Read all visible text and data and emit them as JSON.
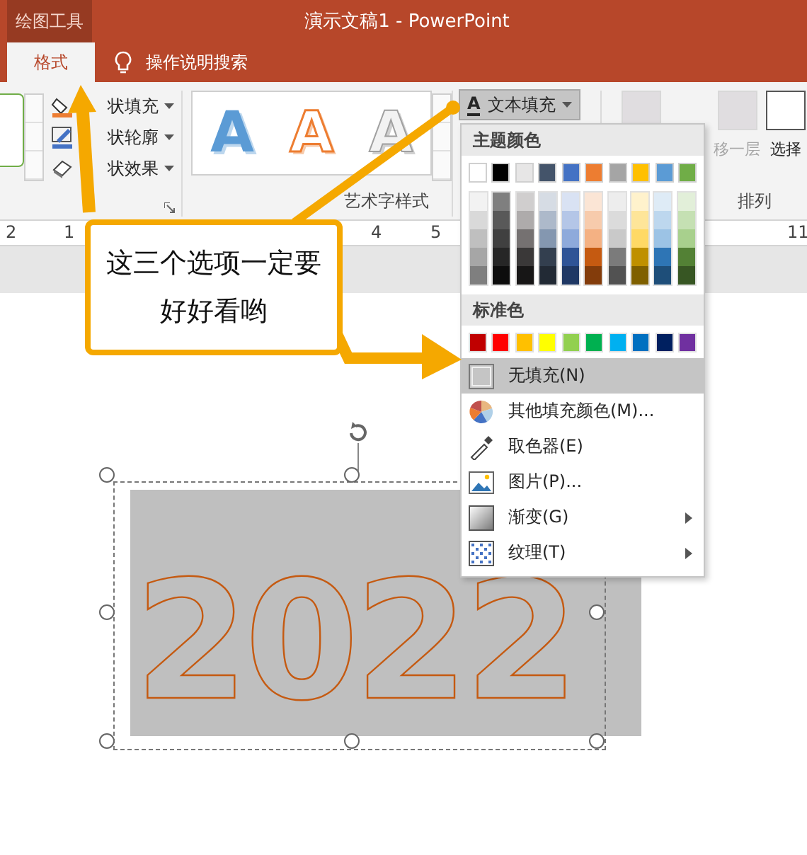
{
  "title_bar": {
    "context_tab": "绘图工具",
    "title": "演示文稿1  -  PowerPoint"
  },
  "tabs": [
    {
      "label": "格式",
      "selected": true
    }
  ],
  "tell_me": "操作说明搜索",
  "ribbon": {
    "shape_commands": [
      {
        "label": "状填充",
        "kind": "fill"
      },
      {
        "label": "状轮廓",
        "kind": "outline"
      },
      {
        "label": "状效果",
        "kind": "effect"
      }
    ],
    "wordart_styles": [
      {
        "sample": "A",
        "kind": "blue"
      },
      {
        "sample": "A",
        "kind": "orange"
      },
      {
        "sample": "A",
        "kind": "gray"
      }
    ],
    "wordart_group": "艺术字样式",
    "text_fill_button": {
      "icon": "A",
      "label": "文本填充",
      "expanded": true
    },
    "arrange": {
      "items": [
        {
          "label": "移一层",
          "disabled": true
        },
        {
          "label": "选择",
          "disabled": false
        }
      ],
      "label": "排列"
    }
  },
  "ruler": [
    "2",
    "1",
    "4",
    "5",
    "11"
  ],
  "menu": {
    "theme_heading": "主题颜色",
    "theme_colors": [
      {
        "color": "#ffffff",
        "shades": [
          {
            "color": "#f2f2f2"
          },
          {
            "color": "#d9d9d9"
          },
          {
            "color": "#bfbfbf"
          },
          {
            "color": "#a6a6a6"
          },
          {
            "color": "#7f7f7f"
          }
        ]
      },
      {
        "color": "#000000",
        "shades": [
          {
            "color": "#7f7f7f"
          },
          {
            "color": "#595959"
          },
          {
            "color": "#404040"
          },
          {
            "color": "#262626"
          },
          {
            "color": "#0d0d0d"
          }
        ]
      },
      {
        "color": "#e7e6e6",
        "shades": [
          {
            "color": "#d0cece"
          },
          {
            "color": "#aeabab"
          },
          {
            "color": "#757171"
          },
          {
            "color": "#3a3838"
          },
          {
            "color": "#171616"
          }
        ]
      },
      {
        "color": "#44546a",
        "shades": [
          {
            "color": "#d6dce4"
          },
          {
            "color": "#adb9ca"
          },
          {
            "color": "#8497b0"
          },
          {
            "color": "#333f4f"
          },
          {
            "color": "#222a35"
          }
        ]
      },
      {
        "color": "#4472c4",
        "shades": [
          {
            "color": "#d9e2f3"
          },
          {
            "color": "#b4c6e7"
          },
          {
            "color": "#8eaadb"
          },
          {
            "color": "#2f5496"
          },
          {
            "color": "#1f3864"
          }
        ]
      },
      {
        "color": "#ed7d31",
        "shades": [
          {
            "color": "#fbe5d5"
          },
          {
            "color": "#f7cbac"
          },
          {
            "color": "#f4b183"
          },
          {
            "color": "#c55a11"
          },
          {
            "color": "#833c0b"
          }
        ]
      },
      {
        "color": "#a5a5a5",
        "shades": [
          {
            "color": "#ededed"
          },
          {
            "color": "#dbdbdb"
          },
          {
            "color": "#c9c9c9"
          },
          {
            "color": "#7b7b7b"
          },
          {
            "color": "#525252"
          }
        ]
      },
      {
        "color": "#ffc000",
        "shades": [
          {
            "color": "#fff2cc"
          },
          {
            "color": "#fee599"
          },
          {
            "color": "#ffd965"
          },
          {
            "color": "#bf9000"
          },
          {
            "color": "#7f6000"
          }
        ]
      },
      {
        "color": "#5b9bd5",
        "shades": [
          {
            "color": "#deebf6"
          },
          {
            "color": "#bdd7ee"
          },
          {
            "color": "#9cc3e5"
          },
          {
            "color": "#2e75b5"
          },
          {
            "color": "#1e4e79"
          }
        ]
      },
      {
        "color": "#70ad47",
        "shades": [
          {
            "color": "#e2efd9"
          },
          {
            "color": "#c5e0b3"
          },
          {
            "color": "#a8d08d"
          },
          {
            "color": "#538135"
          },
          {
            "color": "#375623"
          }
        ]
      }
    ],
    "standard_heading": "标准色",
    "standard_colors": [
      {
        "color": "#c00000"
      },
      {
        "color": "#ff0000"
      },
      {
        "color": "#ffc000"
      },
      {
        "color": "#ffff00"
      },
      {
        "color": "#92d050"
      },
      {
        "color": "#00b050"
      },
      {
        "color": "#00b0f0"
      },
      {
        "color": "#0070c0"
      },
      {
        "color": "#002060"
      },
      {
        "color": "#7030a0"
      }
    ],
    "items": [
      {
        "label": "无填充(N)",
        "kind": "none",
        "selected": true,
        "submenu": false
      },
      {
        "label": "其他填充颜色(M)...",
        "kind": "more-colors",
        "selected": false,
        "submenu": false
      },
      {
        "label": "取色器(E)",
        "kind": "eyedropper",
        "selected": false,
        "submenu": false
      },
      {
        "label": "图片(P)...",
        "kind": "picture",
        "selected": false,
        "submenu": false
      },
      {
        "label": "渐变(G)",
        "kind": "gradient",
        "selected": false,
        "submenu": true
      },
      {
        "label": "纹理(T)",
        "kind": "texture",
        "selected": false,
        "submenu": true
      }
    ]
  },
  "callout": {
    "text": "这三个选项一定要好好看哟"
  },
  "slide": {
    "wordart": "2022"
  }
}
